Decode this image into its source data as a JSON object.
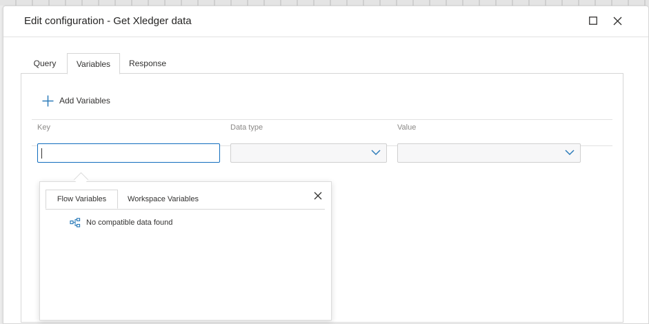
{
  "dialog": {
    "title": "Edit configuration - Get Xledger data",
    "maximize_icon": "maximize-icon",
    "close_icon": "close-icon"
  },
  "tabs": [
    {
      "label": "Query",
      "active": false
    },
    {
      "label": "Variables",
      "active": true
    },
    {
      "label": "Response",
      "active": false
    }
  ],
  "variables_panel": {
    "add_label": "Add Variables",
    "columns": [
      "Key",
      "Data type",
      "Value"
    ],
    "row": {
      "key": "",
      "data_type": "",
      "value": ""
    }
  },
  "variable_picker": {
    "tabs": [
      {
        "label": "Flow Variables",
        "active": true
      },
      {
        "label": "Workspace Variables",
        "active": false
      }
    ],
    "empty_message": "No compatible data found",
    "empty_icon": "flow-diagram-icon"
  },
  "colors": {
    "accent": "#0f6cbd",
    "icon_blue": "#2b7bb9",
    "border": "#d6d6d6",
    "muted_text": "#8a8886"
  }
}
